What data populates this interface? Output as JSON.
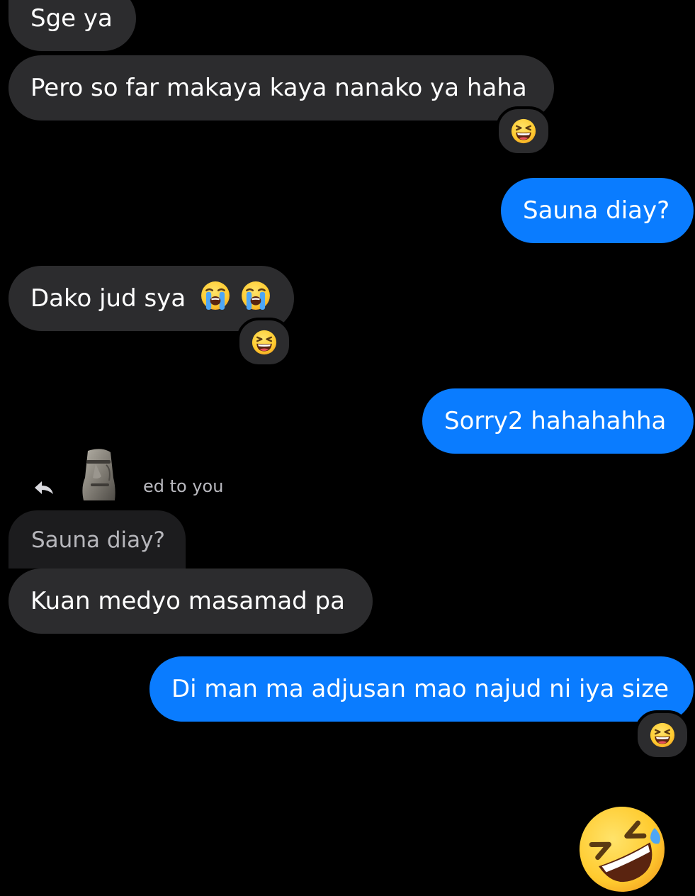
{
  "messages": [
    {
      "id": "m1",
      "sender": "other",
      "text": "Sge ya"
    },
    {
      "id": "m2",
      "sender": "other",
      "text": "Pero so far makaya kaya nanako ya haha",
      "reaction": "grinning-squinting-face"
    },
    {
      "id": "m3",
      "sender": "me",
      "text": "Sauna diay?"
    },
    {
      "id": "m4",
      "sender": "other",
      "text": "Dako jud sya",
      "emojis": [
        "loudly-crying-face",
        "loudly-crying-face"
      ],
      "reaction": "grinning-squinting-face"
    },
    {
      "id": "m5",
      "sender": "me",
      "text": "Sorry2 hahahahha"
    },
    {
      "id": "m6",
      "sender": "other",
      "reply_header": "ed to you",
      "quoted_text": "Sauna diay?",
      "text": "Kuan medyo masamad pa"
    },
    {
      "id": "m7",
      "sender": "me",
      "text": "Di man ma adjusan mao najud ni iya size",
      "reaction": "grinning-squinting-face"
    },
    {
      "id": "m8",
      "sender": "me",
      "emoji": "rolling-on-the-floor-laughing"
    }
  ],
  "colors": {
    "background": "#000000",
    "incoming_bubble": "#2c2c2e",
    "outgoing_bubble": "#0a7cff",
    "quote_bubble": "#1c1c1e",
    "text": "#ffffff",
    "muted_text": "#b6b6bb"
  }
}
